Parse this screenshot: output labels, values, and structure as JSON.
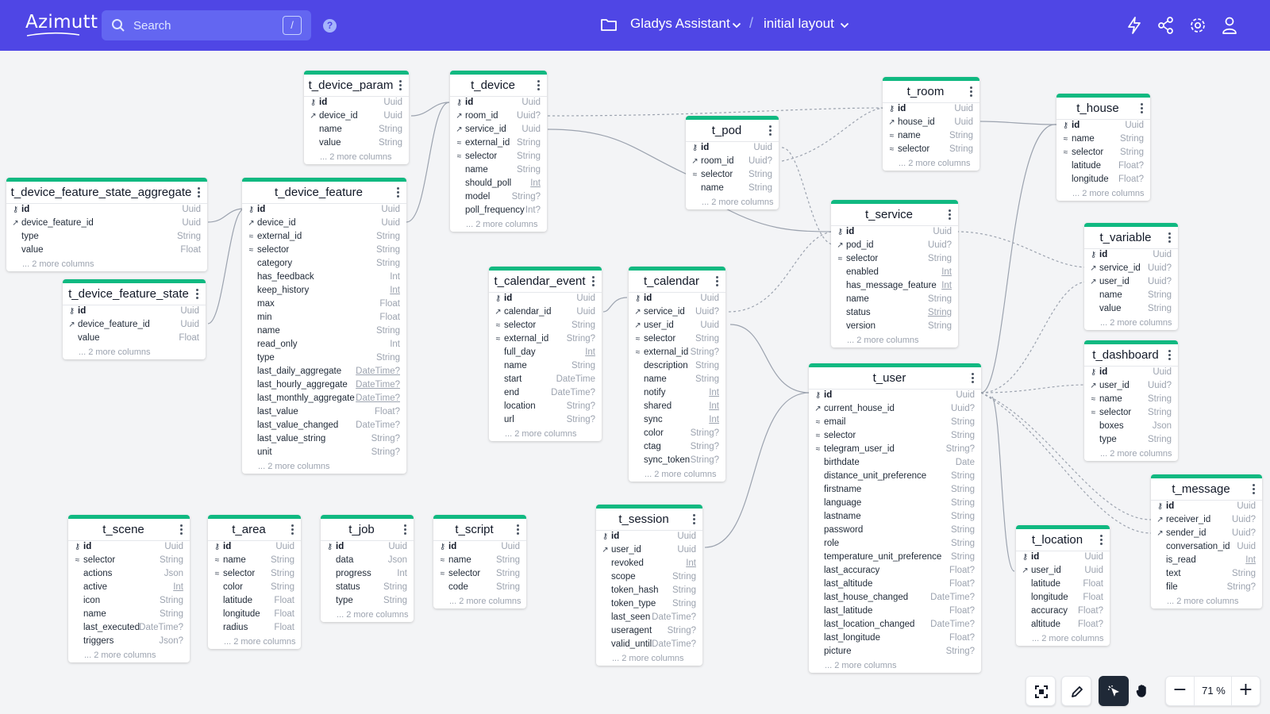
{
  "app": {
    "logo": "Azimutt"
  },
  "header": {
    "search_placeholder": "Search",
    "search_shortcut": "/",
    "project_name": "Gladys Assistant",
    "separator": "/",
    "layout_name": "initial layout"
  },
  "icons": {
    "pk": "key-icon",
    "fk": "external-link-icon",
    "index": "fingerprint-icon",
    "header": [
      "help-icon",
      "folder-icon",
      "chevron-down-icon",
      "lightning-icon",
      "share-icon",
      "gear-icon",
      "user-icon"
    ],
    "toolbar": [
      "fit-screen-icon",
      "pencil-icon",
      "select-cursor-icon",
      "hand-icon"
    ]
  },
  "colors": {
    "header": "#4f46e5",
    "table_accent": "#10b981",
    "canvas": "#f3f4f6"
  },
  "toolbar": {
    "zoom_out": "−",
    "zoom": "71 %",
    "zoom_in": "+"
  },
  "tables": [
    {
      "name": "t_device_param",
      "more": "... 2 more columns",
      "columns": [
        {
          "n": "id",
          "t": "Uuid",
          "k": "pk"
        },
        {
          "n": "device_id",
          "t": "Uuid",
          "k": "fk"
        },
        {
          "n": "name",
          "t": "String"
        },
        {
          "n": "value",
          "t": "String"
        }
      ]
    },
    {
      "name": "t_device",
      "more": "... 2 more columns",
      "columns": [
        {
          "n": "id",
          "t": "Uuid",
          "k": "pk"
        },
        {
          "n": "room_id",
          "t": "Uuid?",
          "k": "fk"
        },
        {
          "n": "service_id",
          "t": "Uuid",
          "k": "fk"
        },
        {
          "n": "external_id",
          "t": "String",
          "k": "idx"
        },
        {
          "n": "selector",
          "t": "String",
          "k": "idx"
        },
        {
          "n": "name",
          "t": "String"
        },
        {
          "n": "should_poll",
          "t": "Int",
          "u": true
        },
        {
          "n": "model",
          "t": "String?"
        },
        {
          "n": "poll_frequency",
          "t": "Int?"
        }
      ]
    },
    {
      "name": "t_room",
      "more": "... 2 more columns",
      "columns": [
        {
          "n": "id",
          "t": "Uuid",
          "k": "pk"
        },
        {
          "n": "house_id",
          "t": "Uuid",
          "k": "fk"
        },
        {
          "n": "name",
          "t": "String",
          "k": "idx"
        },
        {
          "n": "selector",
          "t": "String",
          "k": "idx"
        }
      ]
    },
    {
      "name": "t_house",
      "more": "... 2 more columns",
      "columns": [
        {
          "n": "id",
          "t": "Uuid",
          "k": "pk"
        },
        {
          "n": "name",
          "t": "String",
          "k": "idx"
        },
        {
          "n": "selector",
          "t": "String",
          "k": "idx"
        },
        {
          "n": "latitude",
          "t": "Float?"
        },
        {
          "n": "longitude",
          "t": "Float?"
        }
      ]
    },
    {
      "name": "t_pod",
      "more": "... 2 more columns",
      "columns": [
        {
          "n": "id",
          "t": "Uuid",
          "k": "pk"
        },
        {
          "n": "room_id",
          "t": "Uuid?",
          "k": "fk"
        },
        {
          "n": "selector",
          "t": "String",
          "k": "idx"
        },
        {
          "n": "name",
          "t": "String"
        }
      ]
    },
    {
      "name": "t_device_feature_state_aggregate",
      "more": "... 2 more columns",
      "columns": [
        {
          "n": "id",
          "t": "Uuid",
          "k": "pk"
        },
        {
          "n": "device_feature_id",
          "t": "Uuid",
          "k": "fk"
        },
        {
          "n": "type",
          "t": "String"
        },
        {
          "n": "value",
          "t": "Float"
        }
      ]
    },
    {
      "name": "t_device_feature",
      "more": "... 2 more columns",
      "columns": [
        {
          "n": "id",
          "t": "Uuid",
          "k": "pk"
        },
        {
          "n": "device_id",
          "t": "Uuid",
          "k": "fk"
        },
        {
          "n": "external_id",
          "t": "String",
          "k": "idx"
        },
        {
          "n": "selector",
          "t": "String",
          "k": "idx"
        },
        {
          "n": "category",
          "t": "String"
        },
        {
          "n": "has_feedback",
          "t": "Int"
        },
        {
          "n": "keep_history",
          "t": "Int",
          "u": true
        },
        {
          "n": "max",
          "t": "Float"
        },
        {
          "n": "min",
          "t": "Float"
        },
        {
          "n": "name",
          "t": "String"
        },
        {
          "n": "read_only",
          "t": "Int"
        },
        {
          "n": "type",
          "t": "String"
        },
        {
          "n": "last_daily_aggregate",
          "t": "DateTime?",
          "u": true
        },
        {
          "n": "last_hourly_aggregate",
          "t": "DateTime?",
          "u": true
        },
        {
          "n": "last_monthly_aggregate",
          "t": "DateTime?",
          "u": true
        },
        {
          "n": "last_value",
          "t": "Float?"
        },
        {
          "n": "last_value_changed",
          "t": "DateTime?"
        },
        {
          "n": "last_value_string",
          "t": "String?"
        },
        {
          "n": "unit",
          "t": "String?"
        }
      ]
    },
    {
      "name": "t_service",
      "more": "... 2 more columns",
      "columns": [
        {
          "n": "id",
          "t": "Uuid",
          "k": "pk"
        },
        {
          "n": "pod_id",
          "t": "Uuid?",
          "k": "fk"
        },
        {
          "n": "selector",
          "t": "String",
          "k": "idx"
        },
        {
          "n": "enabled",
          "t": "Int",
          "u": true
        },
        {
          "n": "has_message_feature",
          "t": "Int",
          "u": true
        },
        {
          "n": "name",
          "t": "String"
        },
        {
          "n": "status",
          "t": "String",
          "u": true
        },
        {
          "n": "version",
          "t": "String"
        }
      ]
    },
    {
      "name": "t_variable",
      "more": "... 2 more columns",
      "columns": [
        {
          "n": "id",
          "t": "Uuid",
          "k": "pk"
        },
        {
          "n": "service_id",
          "t": "Uuid?",
          "k": "fk"
        },
        {
          "n": "user_id",
          "t": "Uuid?",
          "k": "fk"
        },
        {
          "n": "name",
          "t": "String"
        },
        {
          "n": "value",
          "t": "String"
        }
      ]
    },
    {
      "name": "t_device_feature_state",
      "more": "... 2 more columns",
      "columns": [
        {
          "n": "id",
          "t": "Uuid",
          "k": "pk"
        },
        {
          "n": "device_feature_id",
          "t": "Uuid",
          "k": "fk"
        },
        {
          "n": "value",
          "t": "Float"
        }
      ]
    },
    {
      "name": "t_calendar_event",
      "more": "... 2 more columns",
      "columns": [
        {
          "n": "id",
          "t": "Uuid",
          "k": "pk"
        },
        {
          "n": "calendar_id",
          "t": "Uuid",
          "k": "fk"
        },
        {
          "n": "selector",
          "t": "String",
          "k": "idx"
        },
        {
          "n": "external_id",
          "t": "String?",
          "k": "idx"
        },
        {
          "n": "full_day",
          "t": "Int",
          "u": true
        },
        {
          "n": "name",
          "t": "String"
        },
        {
          "n": "start",
          "t": "DateTime"
        },
        {
          "n": "end",
          "t": "DateTime?"
        },
        {
          "n": "location",
          "t": "String?"
        },
        {
          "n": "url",
          "t": "String?"
        }
      ]
    },
    {
      "name": "t_calendar",
      "more": "... 2 more columns",
      "columns": [
        {
          "n": "id",
          "t": "Uuid",
          "k": "pk"
        },
        {
          "n": "service_id",
          "t": "Uuid?",
          "k": "fk"
        },
        {
          "n": "user_id",
          "t": "Uuid",
          "k": "fk"
        },
        {
          "n": "selector",
          "t": "String",
          "k": "idx"
        },
        {
          "n": "external_id",
          "t": "String?",
          "k": "idx"
        },
        {
          "n": "description",
          "t": "String"
        },
        {
          "n": "name",
          "t": "String"
        },
        {
          "n": "notify",
          "t": "Int",
          "u": true
        },
        {
          "n": "shared",
          "t": "Int",
          "u": true
        },
        {
          "n": "sync",
          "t": "Int",
          "u": true
        },
        {
          "n": "color",
          "t": "String?"
        },
        {
          "n": "ctag",
          "t": "String?"
        },
        {
          "n": "sync_token",
          "t": "String?"
        }
      ]
    },
    {
      "name": "t_user",
      "more": "... 2 more columns",
      "columns": [
        {
          "n": "id",
          "t": "Uuid",
          "k": "pk"
        },
        {
          "n": "current_house_id",
          "t": "Uuid?",
          "k": "fk"
        },
        {
          "n": "email",
          "t": "String",
          "k": "idx"
        },
        {
          "n": "selector",
          "t": "String",
          "k": "idx"
        },
        {
          "n": "telegram_user_id",
          "t": "String?",
          "k": "idx"
        },
        {
          "n": "birthdate",
          "t": "Date"
        },
        {
          "n": "distance_unit_preference",
          "t": "String"
        },
        {
          "n": "firstname",
          "t": "String"
        },
        {
          "n": "language",
          "t": "String"
        },
        {
          "n": "lastname",
          "t": "String"
        },
        {
          "n": "password",
          "t": "String"
        },
        {
          "n": "role",
          "t": "String"
        },
        {
          "n": "temperature_unit_preference",
          "t": "String"
        },
        {
          "n": "last_accuracy",
          "t": "Float?"
        },
        {
          "n": "last_altitude",
          "t": "Float?"
        },
        {
          "n": "last_house_changed",
          "t": "DateTime?"
        },
        {
          "n": "last_latitude",
          "t": "Float?"
        },
        {
          "n": "last_location_changed",
          "t": "DateTime?"
        },
        {
          "n": "last_longitude",
          "t": "Float?"
        },
        {
          "n": "picture",
          "t": "String?"
        }
      ]
    },
    {
      "name": "t_dashboard",
      "more": "... 2 more columns",
      "columns": [
        {
          "n": "id",
          "t": "Uuid",
          "k": "pk"
        },
        {
          "n": "user_id",
          "t": "Uuid?",
          "k": "fk"
        },
        {
          "n": "name",
          "t": "String",
          "k": "idx"
        },
        {
          "n": "selector",
          "t": "String",
          "k": "idx"
        },
        {
          "n": "boxes",
          "t": "Json"
        },
        {
          "n": "type",
          "t": "String"
        }
      ]
    },
    {
      "name": "t_message",
      "more": "... 2 more columns",
      "columns": [
        {
          "n": "id",
          "t": "Uuid",
          "k": "pk"
        },
        {
          "n": "receiver_id",
          "t": "Uuid?",
          "k": "fk"
        },
        {
          "n": "sender_id",
          "t": "Uuid?",
          "k": "fk"
        },
        {
          "n": "conversation_id",
          "t": "Uuid"
        },
        {
          "n": "is_read",
          "t": "Int",
          "u": true
        },
        {
          "n": "text",
          "t": "String"
        },
        {
          "n": "file",
          "t": "String?"
        }
      ]
    },
    {
      "name": "t_location",
      "more": "... 2 more columns",
      "columns": [
        {
          "n": "id",
          "t": "Uuid",
          "k": "pk"
        },
        {
          "n": "user_id",
          "t": "Uuid",
          "k": "fk"
        },
        {
          "n": "latitude",
          "t": "Float"
        },
        {
          "n": "longitude",
          "t": "Float"
        },
        {
          "n": "accuracy",
          "t": "Float?"
        },
        {
          "n": "altitude",
          "t": "Float?"
        }
      ]
    },
    {
      "name": "t_session",
      "more": "... 2 more columns",
      "columns": [
        {
          "n": "id",
          "t": "Uuid",
          "k": "pk"
        },
        {
          "n": "user_id",
          "t": "Uuid",
          "k": "fk"
        },
        {
          "n": "revoked",
          "t": "Int",
          "u": true
        },
        {
          "n": "scope",
          "t": "String"
        },
        {
          "n": "token_hash",
          "t": "String"
        },
        {
          "n": "token_type",
          "t": "String"
        },
        {
          "n": "last_seen",
          "t": "DateTime?"
        },
        {
          "n": "useragent",
          "t": "String?"
        },
        {
          "n": "valid_until",
          "t": "DateTime?"
        }
      ]
    },
    {
      "name": "t_scene",
      "more": "... 2 more columns",
      "columns": [
        {
          "n": "id",
          "t": "Uuid",
          "k": "pk"
        },
        {
          "n": "selector",
          "t": "String",
          "k": "idx"
        },
        {
          "n": "actions",
          "t": "Json"
        },
        {
          "n": "active",
          "t": "Int",
          "u": true
        },
        {
          "n": "icon",
          "t": "String"
        },
        {
          "n": "name",
          "t": "String"
        },
        {
          "n": "last_executed",
          "t": "DateTime?"
        },
        {
          "n": "triggers",
          "t": "Json?"
        }
      ]
    },
    {
      "name": "t_area",
      "more": "... 2 more columns",
      "columns": [
        {
          "n": "id",
          "t": "Uuid",
          "k": "pk"
        },
        {
          "n": "name",
          "t": "String",
          "k": "idx"
        },
        {
          "n": "selector",
          "t": "String",
          "k": "idx"
        },
        {
          "n": "color",
          "t": "String"
        },
        {
          "n": "latitude",
          "t": "Float"
        },
        {
          "n": "longitude",
          "t": "Float"
        },
        {
          "n": "radius",
          "t": "Float"
        }
      ]
    },
    {
      "name": "t_job",
      "more": "... 2 more columns",
      "columns": [
        {
          "n": "id",
          "t": "Uuid",
          "k": "pk"
        },
        {
          "n": "data",
          "t": "Json"
        },
        {
          "n": "progress",
          "t": "Int"
        },
        {
          "n": "status",
          "t": "String"
        },
        {
          "n": "type",
          "t": "String"
        }
      ]
    },
    {
      "name": "t_script",
      "more": "... 2 more columns",
      "columns": [
        {
          "n": "id",
          "t": "Uuid",
          "k": "pk"
        },
        {
          "n": "name",
          "t": "String",
          "k": "idx"
        },
        {
          "n": "selector",
          "t": "String",
          "k": "idx"
        },
        {
          "n": "code",
          "t": "String"
        }
      ]
    }
  ]
}
